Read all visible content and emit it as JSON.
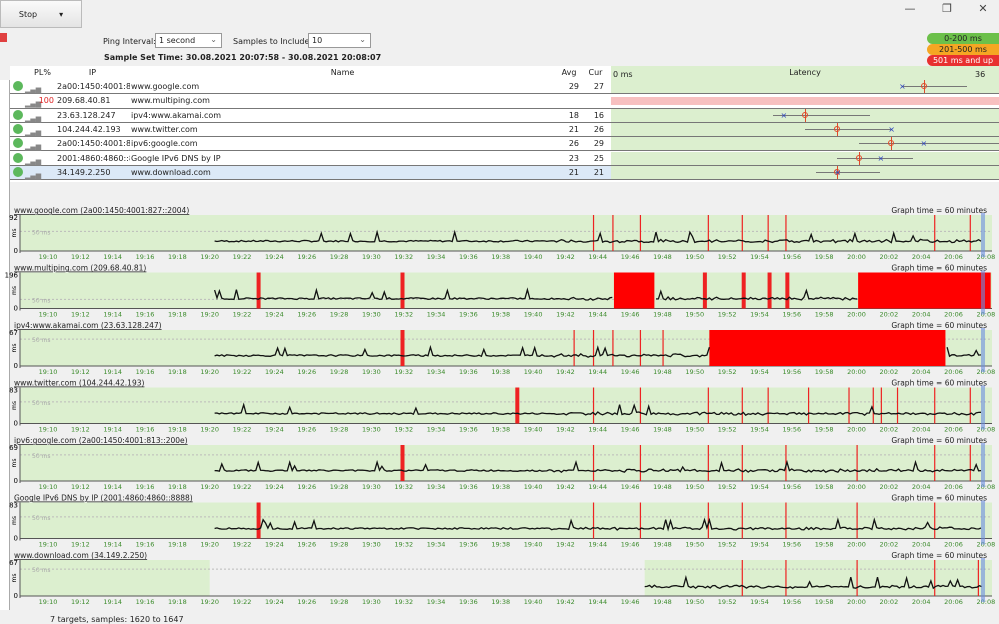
{
  "window": {
    "minimize": "—",
    "restore": "❐",
    "close": "✕"
  },
  "toolbar": {
    "stop_label": "Stop",
    "ping_interval_label": "Ping Interval:",
    "ping_interval_value": "1 second",
    "samples_label": "Samples to Include:",
    "samples_value": "10",
    "sample_set_time": "Sample Set Time: 30.08.2021 20:07:58 - 30.08.2021 20:08:07"
  },
  "legend": [
    {
      "label": "0-200 ms",
      "color": "#6cc04a"
    },
    {
      "label": "201-500 ms",
      "color": "#f5a623"
    },
    {
      "label": "501 ms and up",
      "color": "#e83030"
    }
  ],
  "table": {
    "headers": {
      "pl": "PL%",
      "ip": "IP",
      "name": "Name",
      "avg": "Avg",
      "cur": "Cur",
      "latency": "Latency",
      "lat_min": "0 ms",
      "lat_max": "36 ms"
    },
    "latency_scale_ms": 36,
    "rows": [
      {
        "pl": "",
        "ip": "2a00:1450:4001:827::2004",
        "name": "www.google.com",
        "avg": "29",
        "cur": "27",
        "min": 27,
        "max": 33,
        "ok": true
      },
      {
        "pl": "100",
        "ip": "209.68.40.81",
        "name": "www.multiping.com",
        "avg": "",
        "cur": "",
        "ok": false
      },
      {
        "pl": "",
        "ip": "23.63.128.247",
        "name": "ipv4:www.akamai.com",
        "avg": "18",
        "cur": "16",
        "min": 15,
        "max": 24,
        "ok": true
      },
      {
        "pl": "",
        "ip": "104.244.42.193",
        "name": "www.twitter.com",
        "avg": "21",
        "cur": "26",
        "min": 18,
        "max": 26,
        "ok": true
      },
      {
        "pl": "",
        "ip": "2a00:1450:4001:813::200e",
        "name": "ipv6:google.com",
        "avg": "26",
        "cur": "29",
        "min": 23,
        "max": 36,
        "ok": true
      },
      {
        "pl": "",
        "ip": "2001:4860:4860::8888",
        "name": "Google IPv6 DNS by IP",
        "avg": "23",
        "cur": "25",
        "min": 21,
        "max": 28,
        "ok": true
      },
      {
        "pl": "",
        "ip": "34.149.2.250",
        "name": "www.download.com",
        "avg": "21",
        "cur": "21",
        "min": 19,
        "max": 25,
        "ok": true
      }
    ]
  },
  "graphs": {
    "graph_time": "Graph time = 60 minutes",
    "y_unit": "ms",
    "ref_line": "50 ms",
    "x_ticks": [
      "19:10",
      "19:12",
      "19:14",
      "19:16",
      "19:18",
      "19:20",
      "19:22",
      "19:24",
      "19:26",
      "19:28",
      "19:30",
      "19:32",
      "19:34",
      "19:36",
      "19:38",
      "19:40",
      "19:42",
      "19:44",
      "19:46",
      "19:48",
      "19:50",
      "19:52",
      "19:54",
      "19:56",
      "19:58",
      "20:00",
      "20:02",
      "20:04",
      "20:06",
      "20:08"
    ],
    "panels": [
      {
        "title": "www.google.com (2a00:1450:4001:827::2004)",
        "ymax": "92",
        "start": 20.3,
        "loss": [
          43.7,
          44.9,
          46.6,
          50.8,
          52.9,
          54.5,
          55.6,
          64.8,
          67.0
        ],
        "blocks": []
      },
      {
        "title": "www.multiping.com (209.68.40.81)",
        "ymax": "196",
        "start": 20.3,
        "loss": [
          22.9,
          31.8,
          50.5,
          52.9,
          54.5,
          55.6
        ],
        "blocks": [
          [
            45.0,
            47.5
          ],
          [
            60.1,
            68.3
          ]
        ]
      },
      {
        "title": "ipv4:www.akamai.com (23.63.128.247)",
        "ymax": "67",
        "start": 20.3,
        "loss": [
          31.8,
          42.5,
          43.7,
          44.9,
          46.6,
          48.0
        ],
        "blocks": [
          [
            50.9,
            65.5
          ]
        ]
      },
      {
        "title": "www.twitter.com (104.244.42.193)",
        "ymax": "83",
        "start": 20.3,
        "loss": [
          38.9,
          43.7,
          46.6,
          50.8,
          52.9,
          54.5,
          57.0,
          59.5,
          61.0,
          61.5,
          62.5,
          64.8,
          67.0
        ],
        "blocks": []
      },
      {
        "title": "ipv6:google.com (2a00:1450:4001:813::200e)",
        "ymax": "69",
        "start": 20.3,
        "loss": [
          31.8,
          43.7,
          46.6,
          50.8,
          52.9,
          55.6,
          60.0,
          64.8,
          67.0
        ],
        "blocks": []
      },
      {
        "title": "Google IPv6 DNS by IP (2001:4860:4860::8888)",
        "ymax": "83",
        "start": 20.3,
        "loss": [
          22.9,
          43.7,
          46.6,
          50.8,
          52.9,
          55.6,
          60.0,
          64.8
        ],
        "blocks": []
      },
      {
        "title": "www.download.com (34.149.2.250)",
        "ymax": "67",
        "start": 46.9,
        "loss": [
          52.9,
          55.6,
          60.0,
          64.8,
          67.5
        ],
        "blocks": []
      }
    ]
  },
  "status": "7 targets, samples: 1620 to 1647"
}
